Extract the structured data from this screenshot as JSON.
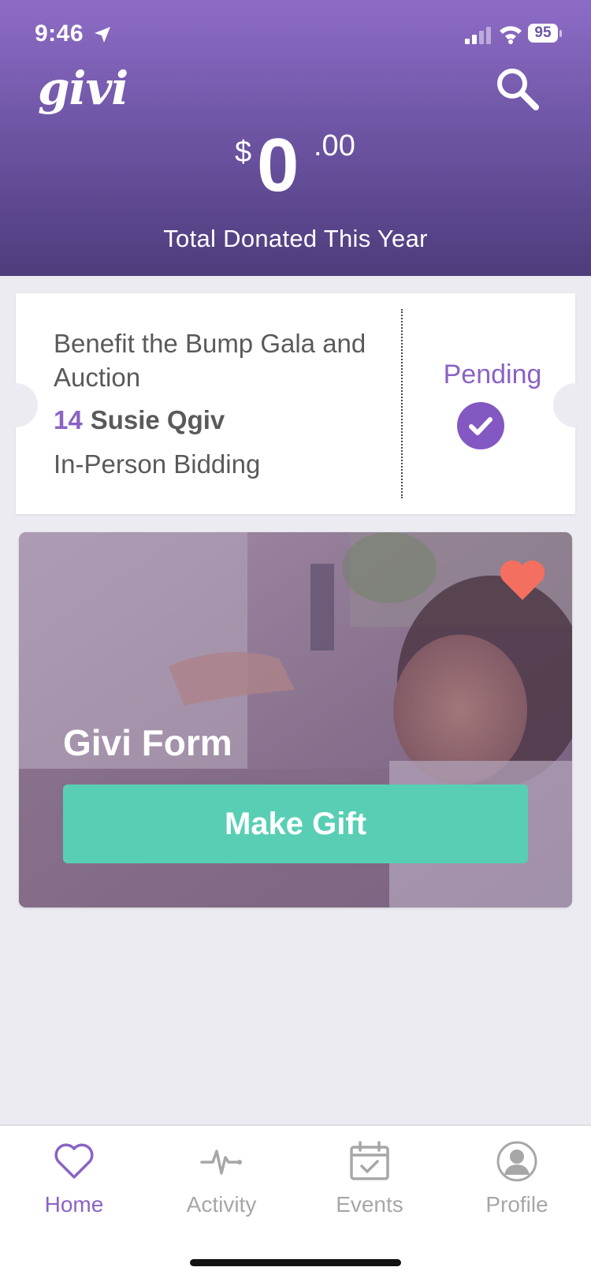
{
  "status_bar": {
    "time": "9:46",
    "battery": "95"
  },
  "header": {
    "logo": "givi",
    "amount": {
      "currency": "$",
      "whole": "0",
      "cents": ".00"
    },
    "total_label": "Total Donated This Year",
    "colors": {
      "gradient_top": "#8e6cc6",
      "gradient_bottom": "#4e3c7c"
    }
  },
  "ticket": {
    "event_name": "Benefit the Bump Gala and Auction",
    "bidder_number": "14",
    "bidder_name": "Susie Qgiv",
    "bid_type": "In-Person Bidding",
    "status": "Pending",
    "accent": "#8a63c4"
  },
  "form_card": {
    "title": "Givi Form",
    "button_label": "Make Gift",
    "button_color": "#58cfb4",
    "favorite_icon": "heart-icon"
  },
  "tabbar": {
    "tabs": [
      {
        "label": "Home",
        "icon": "heart-icon",
        "active": true
      },
      {
        "label": "Activity",
        "icon": "pulse-icon",
        "active": false
      },
      {
        "label": "Events",
        "icon": "calendar-check-icon",
        "active": false
      },
      {
        "label": "Profile",
        "icon": "person-icon",
        "active": false
      }
    ]
  }
}
